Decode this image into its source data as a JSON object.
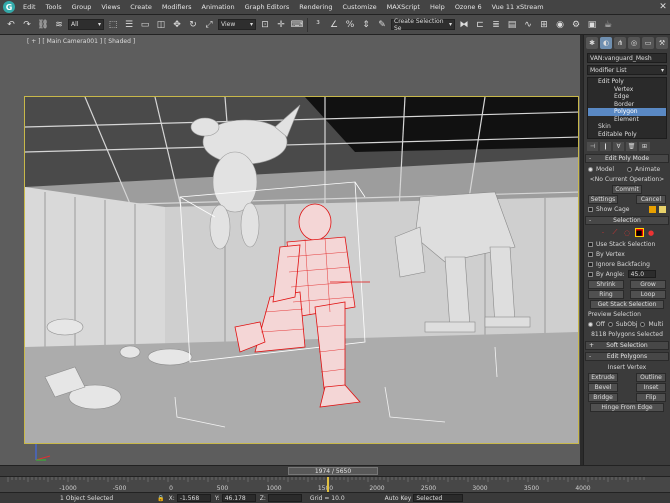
{
  "menu": {
    "items": [
      "Edit",
      "Tools",
      "Group",
      "Views",
      "Create",
      "Modifiers",
      "Animation",
      "Graph Editors",
      "Rendering",
      "Customize",
      "MAXScript",
      "Help",
      "Ozone 6",
      "Vue 11 xStream"
    ]
  },
  "toolbar": {
    "filter_value": "All",
    "view_value": "View",
    "selection_set_placeholder": "Create Selection Se"
  },
  "viewport": {
    "label": "[ + ] [ Main Camera001 ] [ Shaded ]"
  },
  "command_panel": {
    "object_name": "VAN:vanguard_Mesh",
    "modifier_list_label": "Modifier List",
    "stack": {
      "edit_poly": "Edit Poly",
      "vertex": "Vertex",
      "edge": "Edge",
      "border": "Border",
      "polygon": "Polygon",
      "element": "Element",
      "skin": "Skin",
      "editable_poly": "Editable Poly"
    },
    "edit_poly_mode": {
      "title": "Edit Poly Mode",
      "model": "Model",
      "animate": "Animate",
      "current_op": "<No Current Operation>",
      "commit": "Commit",
      "settings": "Settings",
      "cancel": "Cancel",
      "show_cage": "Show Cage",
      "cage_colors": [
        "#e8a000",
        "#e8d26a"
      ]
    },
    "selection": {
      "title": "Selection",
      "use_stack_selection": "Use Stack Selection",
      "by_vertex": "By Vertex",
      "ignore_backfacing": "Ignore Backfacing",
      "by_angle": "By Angle:",
      "angle_value": "45.0",
      "shrink": "Shrink",
      "grow": "Grow",
      "ring": "Ring",
      "loop": "Loop",
      "get_stack_selection": "Get Stack Selection",
      "preview_selection": "Preview Selection",
      "off": "Off",
      "subobj": "SubObj",
      "multi": "Multi",
      "status": "8118 Polygons Selected"
    },
    "soft_selection": {
      "title": "Soft Selection"
    },
    "edit_polygons": {
      "title": "Edit Polygons",
      "insert_vertex": "Insert Vertex",
      "extrude": "Extrude",
      "outline": "Outline",
      "bevel": "Bevel",
      "inset": "Inset",
      "bridge": "Bridge",
      "flip": "Flip",
      "hinge_from_edge": "Hinge From Edge"
    }
  },
  "timeline": {
    "frame_display": "1974 / 5650",
    "ticks": [
      "-1000",
      "-500",
      "0",
      "500",
      "1000",
      "1500",
      "2000",
      "2500",
      "3000",
      "3500",
      "4000"
    ]
  },
  "status": {
    "selected": "1 Object Selected",
    "x": "-1.568",
    "y": "46.178",
    "grid": "Grid = 10.0",
    "auto_key": "Auto Key",
    "key_mode": "Selected"
  }
}
